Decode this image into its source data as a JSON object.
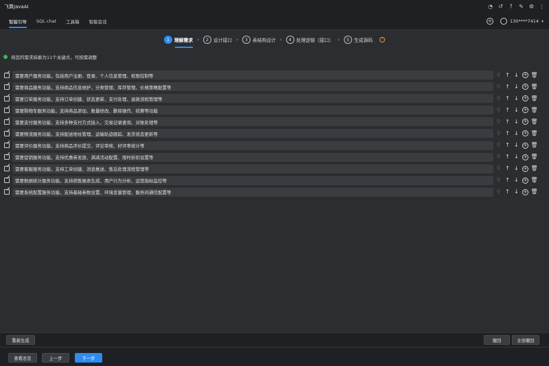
{
  "app": {
    "title": "飞算JavaAI"
  },
  "titlebar": {
    "icons": [
      "timer-icon",
      "history-icon",
      "help-icon",
      "edit-icon",
      "settings-icon",
      "more-icon"
    ]
  },
  "tabs": [
    {
      "label": "智能引导",
      "active": true
    },
    {
      "label": "SQL chat",
      "active": false
    },
    {
      "label": "工具箱",
      "active": false
    },
    {
      "label": "智能会话",
      "active": false
    }
  ],
  "user": {
    "name": "130****7414"
  },
  "steps": [
    {
      "num": "1",
      "label": "理解需求",
      "active": true
    },
    {
      "num": "2",
      "label": "设计接口",
      "active": false
    },
    {
      "num": "3",
      "label": "表结构设计",
      "active": false
    },
    {
      "num": "4",
      "label": "处理逻辑（接口）",
      "active": false
    },
    {
      "num": "5",
      "label": "生成源码",
      "active": false
    }
  ],
  "notice": "将您的需求拆解为11个关键点，可按需调整",
  "requirements": [
    "需要用户服务功能，包括用户注册、登录、个人信息管理、权限控制等",
    "需要商品服务功能，支持商品信息维护、分类管理、库存管理、价格策略配置等",
    "需要订单服务功能，支持订单创建、状态更新、支付处理、退款流程管理等",
    "需要购物车服务功能，支持商品添加、数量修改、删除操作、结算等功能",
    "需要支付服务功能，支持多种支付方式接入、交易记录查询、对账处理等",
    "需要物流服务功能，支持配送地址管理、运输轨迹跟踪、发货状态更新等",
    "需要评价服务功能，支持商品评价提交、评论审核、好评率统计等",
    "需要促销服务功能，支持优惠券发放、满减活动配置、限时折扣设置等",
    "需要客服服务功能，支持工单创建、消息推送、售后处理流程管理等",
    "需要数据统计服务功能，支持销售报表生成、用户行为分析、运营指标监控等",
    "需要系统配置服务功能，支持基础参数设置、环境变量管理、服务间通信配置等"
  ],
  "buttons": {
    "regenerate": "重新生成",
    "undo": "撤回",
    "undo_all": "全部撤回",
    "view_overview": "查看总览",
    "prev": "上一步",
    "next": "下一步"
  },
  "colors": {
    "accent": "#2d8cf0",
    "status_ok": "#3cba54",
    "warning": "#e6a23c"
  }
}
